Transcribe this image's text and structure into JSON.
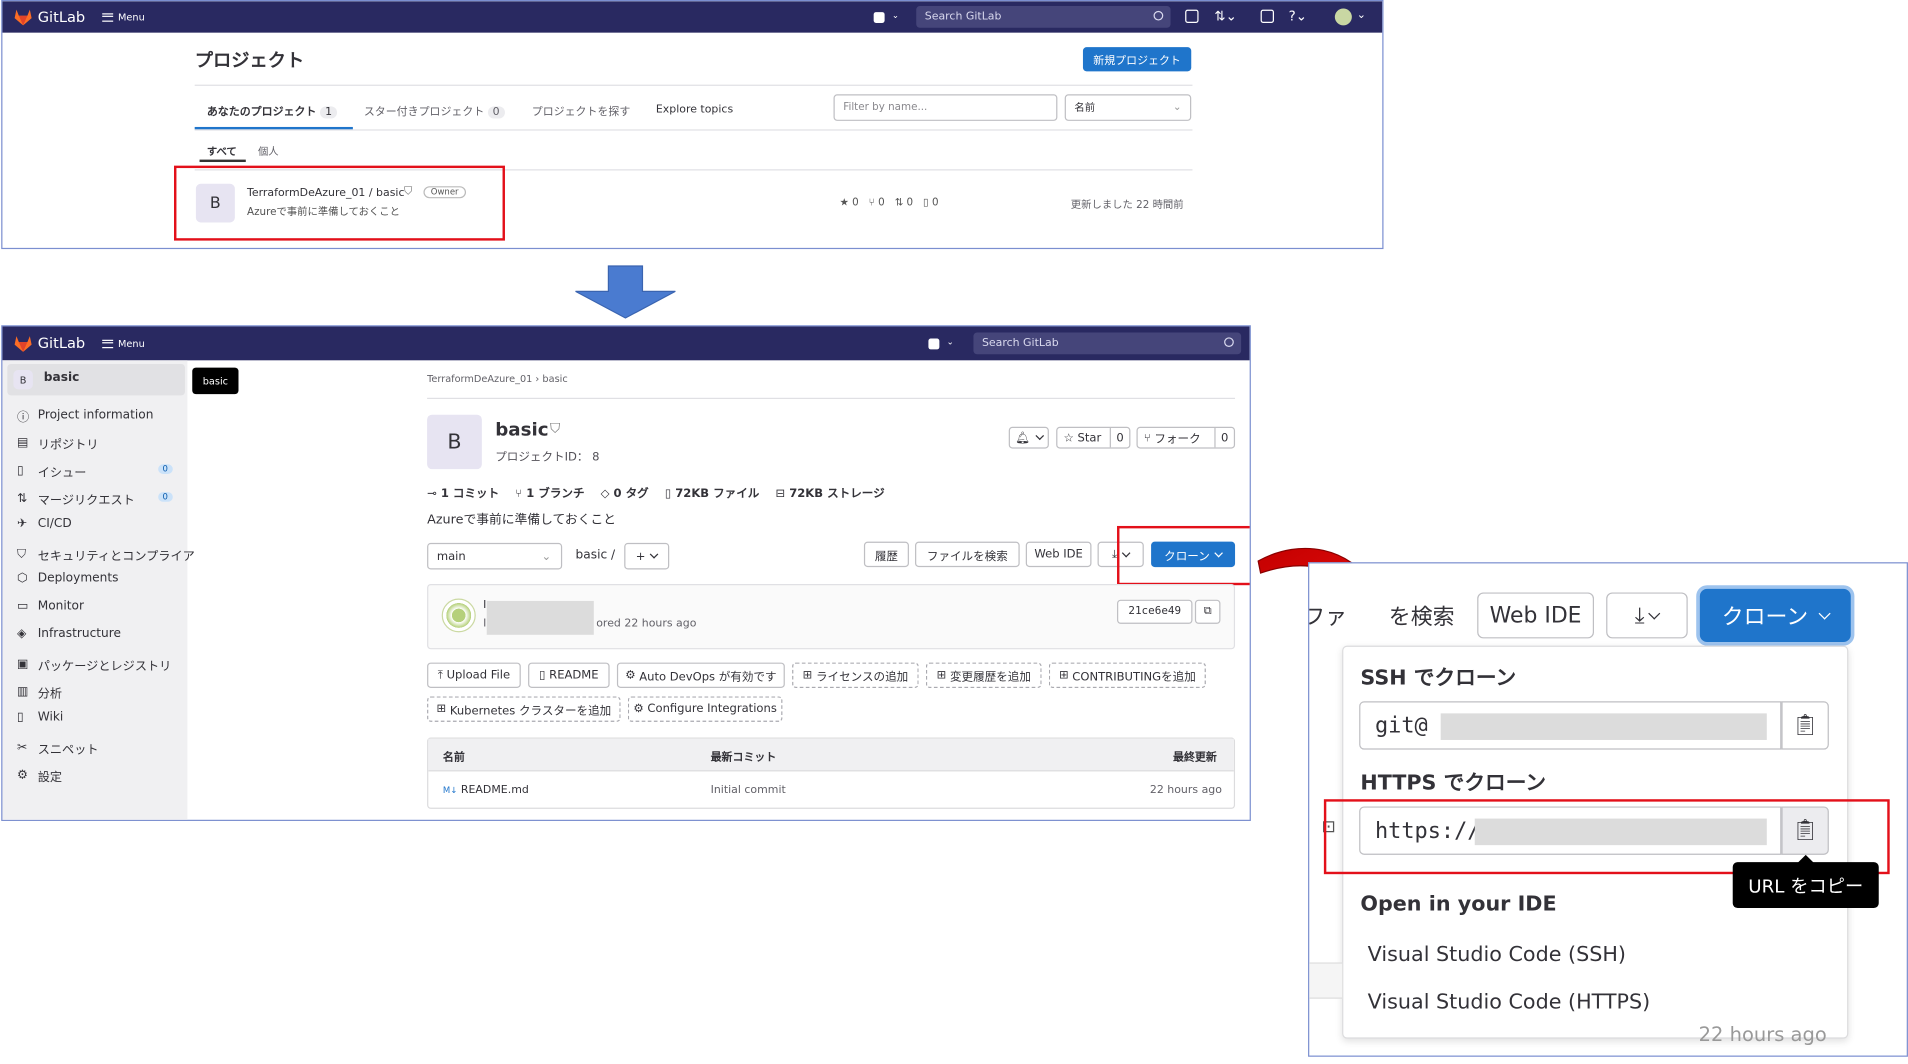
{
  "top": {
    "brand": "GitLab",
    "menu": "Menu",
    "search_placeholder": "Search GitLab",
    "page_title": "プロジェクト",
    "new_project": "新規プロジェクト",
    "tabs": [
      {
        "label": "あなたのプロジェクト",
        "count": "1"
      },
      {
        "label": "スター付きプロジェクト",
        "count": "0"
      },
      {
        "label": "プロジェクトを探す"
      },
      {
        "label": "Explore topics"
      }
    ],
    "filter_placeholder": "Filter by name...",
    "sort_value": "名前",
    "subtabs": [
      "すべて",
      "個人"
    ],
    "project": {
      "avatar": "B",
      "name": "TerraformDeAzure_01 / basic",
      "role": "Owner",
      "description": "Azureで事前に準備しておくこと",
      "stars": "0",
      "forks": "0",
      "mrs": "0",
      "issues": "0",
      "updated": "更新しました 22 時間前"
    }
  },
  "main": {
    "brand": "GitLab",
    "menu": "Menu",
    "search_placeholder": "Search GitLab",
    "sidebar": {
      "avatar": "B",
      "project": "basic",
      "tooltip": "basic",
      "items": [
        {
          "label": "Project information",
          "icon": "info-icon"
        },
        {
          "label": "リポジトリ",
          "icon": "repository-icon"
        },
        {
          "label": "イシュー",
          "icon": "issues-icon",
          "count": "0"
        },
        {
          "label": "マージリクエスト",
          "icon": "merge-request-icon",
          "count": "0"
        },
        {
          "label": "CI/CD",
          "icon": "rocket-icon"
        },
        {
          "label": "セキュリティとコンプライア",
          "icon": "shield-icon"
        },
        {
          "label": "Deployments",
          "icon": "deployments-icon"
        },
        {
          "label": "Monitor",
          "icon": "monitor-icon"
        },
        {
          "label": "Infrastructure",
          "icon": "infrastructure-icon"
        },
        {
          "label": "パッケージとレジストリ",
          "icon": "package-icon"
        },
        {
          "label": "分析",
          "icon": "chart-icon"
        },
        {
          "label": "Wiki",
          "icon": "book-icon"
        },
        {
          "label": "スニペット",
          "icon": "snippet-icon"
        },
        {
          "label": "設定",
          "icon": "gear-icon"
        }
      ]
    },
    "breadcrumb": [
      "TerraformDeAzure_01",
      "basic"
    ],
    "project": {
      "avatar": "B",
      "name": "basic",
      "id_label": "プロジェクトID： 8",
      "star": "Star",
      "star_count": "0",
      "fork": "フォーク",
      "fork_count": "0"
    },
    "stats": [
      "1 コミット",
      "1 ブランチ",
      "0 タグ",
      "72KB ファイル",
      "72KB ストレージ"
    ],
    "description": "Azureで事前に準備しておくこと",
    "branch": "main",
    "path": "basic",
    "path_sep": "/",
    "add": "+",
    "actions": {
      "history": "履歴",
      "find_file": "ファイルを検索",
      "web_ide": "Web IDE",
      "clone": "クローン"
    },
    "commit": {
      "line1": "I",
      "line2": "I",
      "suffix": "ored 22 hours ago",
      "sha": "21ce6e49"
    },
    "quick_actions": [
      "Upload File",
      "README",
      "Auto DevOps が有効です",
      "ライセンスの追加",
      "変更履歴を追加",
      "CONTRIBUTINGを追加",
      "Kubernetes クラスターを追加",
      "Configure Integrations"
    ],
    "table": {
      "headers": [
        "名前",
        "最新コミット",
        "最終更新"
      ],
      "rows": [
        {
          "name": "README.md",
          "commit": "Initial commit",
          "updated": "22 hours ago"
        }
      ]
    }
  },
  "zoom": {
    "find_file_partial_a": "ファ",
    "find_file_partial_b": "を検索",
    "web_ide": "Web IDE",
    "clone": "クローン",
    "ssh_title": "SSH でクローン",
    "ssh_value": "git@",
    "https_title": "HTTPS でクローン",
    "https_value": "https://",
    "tooltip": "URL をコピー",
    "ide_title": "Open in your IDE",
    "ide_options": [
      "Visual Studio Code (SSH)",
      "Visual Studio Code (HTTPS)"
    ],
    "behind_text": "22 hours ago"
  },
  "colors": {
    "navbar": "#292961",
    "primary": "#1f75cb",
    "highlight": "#e3101a",
    "arrow": "#4a7bd0"
  }
}
